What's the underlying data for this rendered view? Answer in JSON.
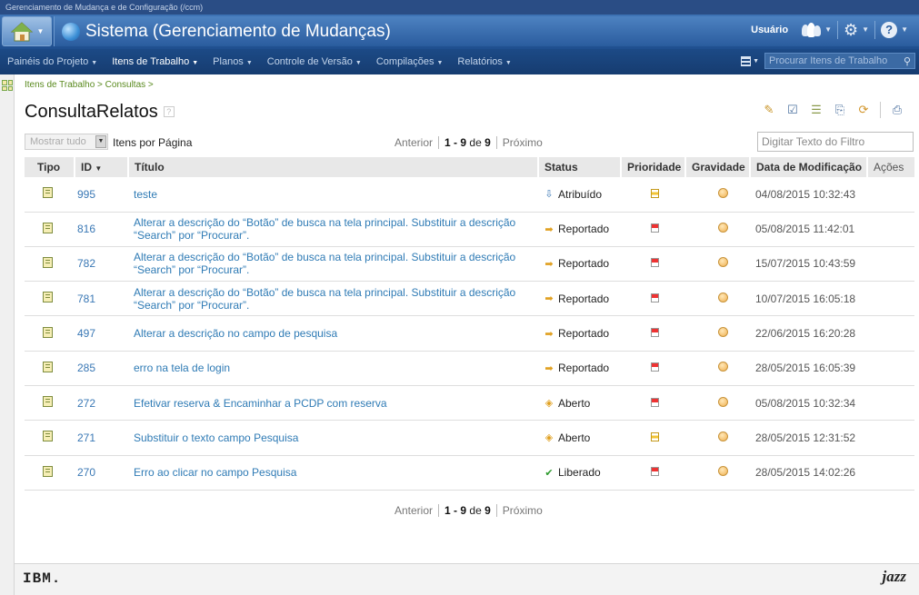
{
  "window": {
    "top_title": "Gerenciamento de Mudança e de Configuração (/ccm)"
  },
  "header": {
    "app_title": "Sistema (Gerenciamento de Mudanças)",
    "user_label": "Usuário"
  },
  "nav": {
    "items": [
      {
        "label": "Painéis do Projeto"
      },
      {
        "label": "Itens de Trabalho"
      },
      {
        "label": "Planos"
      },
      {
        "label": "Controle de Versão"
      },
      {
        "label": "Compilações"
      },
      {
        "label": "Relatórios"
      }
    ],
    "search_placeholder": "Procurar Itens de Trabalho"
  },
  "breadcrumb": "Itens de Trabalho > Consultas >",
  "page_title": "ConsultaRelatos",
  "controls": {
    "show_all": "Mostrar tudo",
    "items_per_page": "Itens por Página",
    "filter_placeholder": "Digitar Texto do Filtro"
  },
  "pager": {
    "prev": "Anterior",
    "range": "1 - 9",
    "of": "de",
    "total": "9",
    "next": "Próximo"
  },
  "table": {
    "columns": [
      "Tipo",
      "ID",
      "Título",
      "Status",
      "Prioridade",
      "Gravidade",
      "Data de Modificação",
      "Ações"
    ],
    "rows": [
      {
        "id": "995",
        "title": "teste",
        "status": "Atribuído",
        "status_icon": "assigned",
        "priority": "medium",
        "date": "04/08/2015 10:32:43"
      },
      {
        "id": "816",
        "title": "Alterar a descrição do “Botão” de busca na tela principal. Substituir a descrição “Search” por “Procurar”.",
        "status": "Reportado",
        "status_icon": "reported",
        "priority": "high",
        "date": "05/08/2015 11:42:01"
      },
      {
        "id": "782",
        "title": "Alterar a descrição do “Botão” de busca na tela principal. Substituir a descrição “Search” por “Procurar”.",
        "status": "Reportado",
        "status_icon": "reported",
        "priority": "high",
        "date": "15/07/2015 10:43:59"
      },
      {
        "id": "781",
        "title": "Alterar a descrição do “Botão” de busca na tela principal. Substituir a descrição “Search” por “Procurar”.",
        "status": "Reportado",
        "status_icon": "reported",
        "priority": "high",
        "date": "10/07/2015 16:05:18"
      },
      {
        "id": "497",
        "title": "Alterar a descrição no campo de pesquisa",
        "status": "Reportado",
        "status_icon": "reported",
        "priority": "high",
        "date": "22/06/2015 16:20:28"
      },
      {
        "id": "285",
        "title": "erro na tela de login",
        "status": "Reportado",
        "status_icon": "reported",
        "priority": "high",
        "date": "28/05/2015 16:05:39"
      },
      {
        "id": "272",
        "title": "Efetivar reserva & Encaminhar a PCDP com reserva",
        "status": "Aberto",
        "status_icon": "open",
        "priority": "high",
        "date": "05/08/2015 10:32:34"
      },
      {
        "id": "271",
        "title": "Substituir o texto campo Pesquisa",
        "status": "Aberto",
        "status_icon": "open",
        "priority": "medium",
        "date": "28/05/2015 12:31:52"
      },
      {
        "id": "270",
        "title": "Erro ao clicar no campo Pesquisa",
        "status": "Liberado",
        "status_icon": "released",
        "priority": "high",
        "date": "28/05/2015 14:02:26"
      }
    ]
  },
  "footer": {
    "left_logo": "IBM.",
    "right_logo": "jazz"
  },
  "colors": {
    "header_bg": "#2a5c9e",
    "nav_bg": "#1c4a86",
    "link": "#2f7bb5",
    "breadcrumb": "#5a8a1f"
  }
}
